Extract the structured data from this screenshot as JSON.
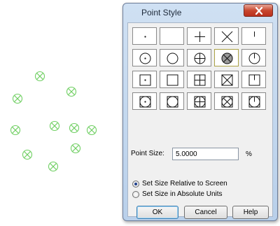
{
  "canvas": {
    "point_color": "#6fcf62",
    "points": [
      {
        "style": "circle-x"
      },
      {
        "style": "circle-x"
      },
      {
        "style": "circle-x"
      },
      {
        "style": "circle-x"
      },
      {
        "style": "circle-x"
      },
      {
        "style": "circle-x"
      },
      {
        "style": "circle-x"
      },
      {
        "style": "circle-x"
      },
      {
        "style": "circle-x"
      },
      {
        "style": "circle-x"
      },
      {
        "style": "circle-x"
      }
    ]
  },
  "dialog": {
    "title": "Point Style",
    "close_icon": "close-icon",
    "point_styles": [
      [
        "dot",
        "none",
        "plus",
        "x",
        "tick"
      ],
      [
        "circle-dot",
        "circle",
        "circle-plus",
        "circle-x",
        "circle-tick"
      ],
      [
        "square-dot",
        "square",
        "square-plus",
        "square-x",
        "square-tick"
      ],
      [
        "circle-square-dot",
        "circle-square",
        "circle-square-plus",
        "circle-square-x",
        "circle-square-tick"
      ]
    ],
    "selected_style": "circle-x",
    "point_size_label": "Point Size:",
    "point_size_value": "5.0000",
    "point_size_unit": "%",
    "radio_relative_label": "Set Size Relative to Screen",
    "radio_absolute_label": "Set Size in Absolute Units",
    "relative_checked": true,
    "ok_label": "OK",
    "cancel_label": "Cancel",
    "help_label": "Help"
  }
}
